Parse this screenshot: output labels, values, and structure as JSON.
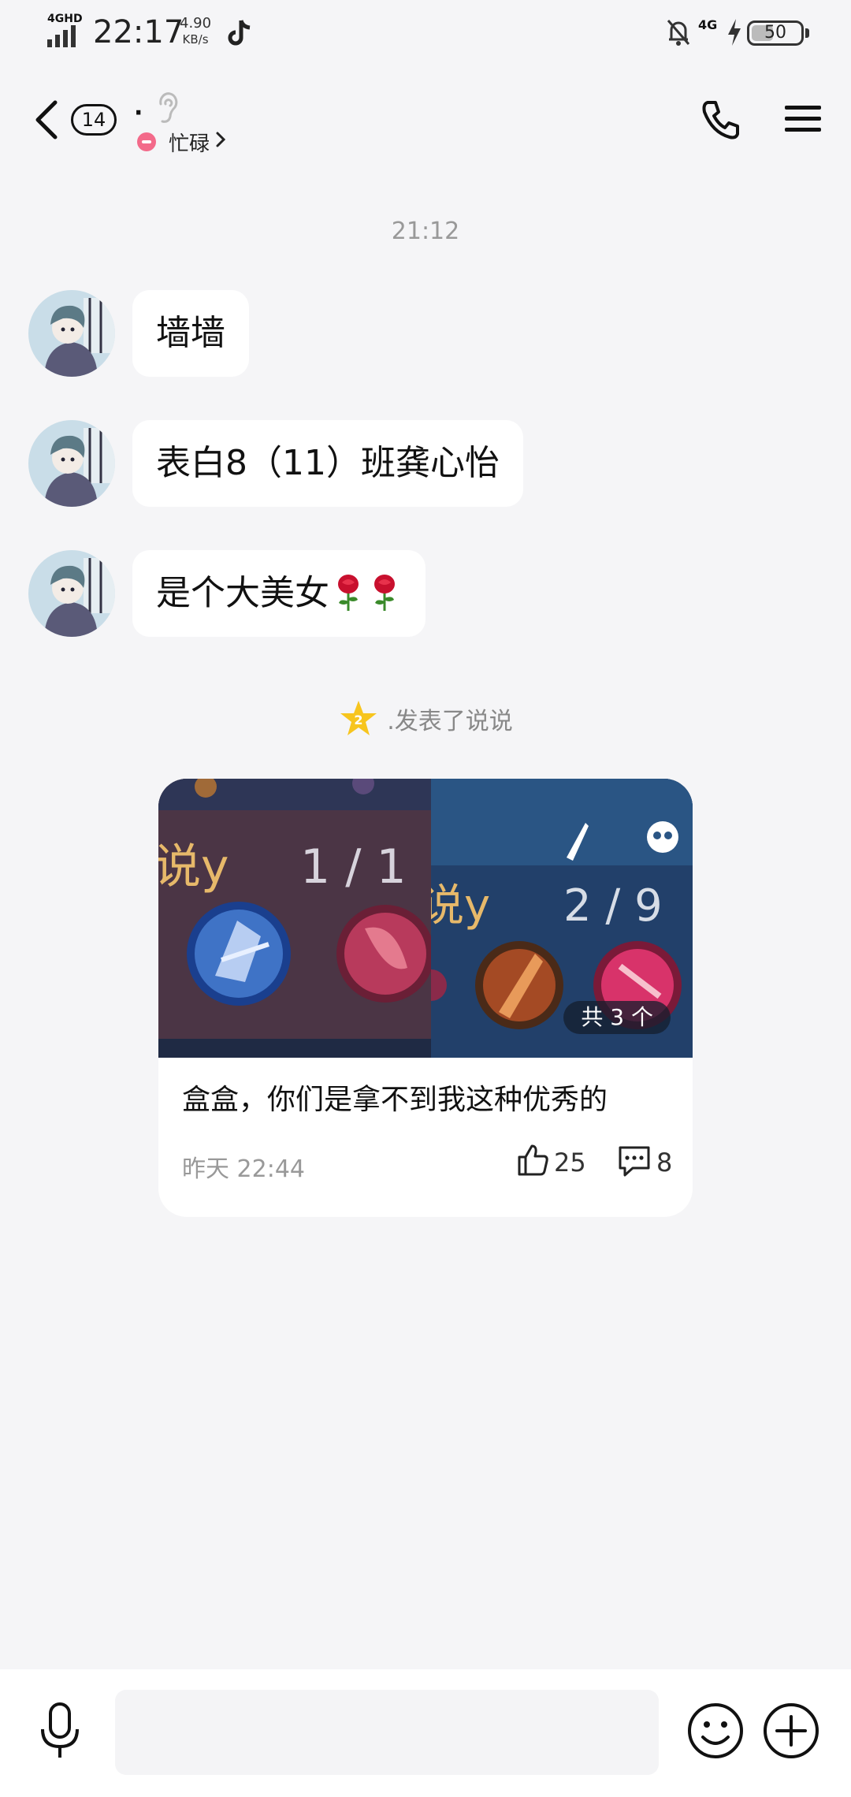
{
  "status_bar": {
    "network_label": "4GHD",
    "time": "22:17",
    "speed_value": "4.90",
    "speed_unit": "KB/s",
    "cell_label": "4G",
    "battery": "50",
    "battery_level": 0.5
  },
  "header": {
    "unread_count": "14",
    "contact_name": "·",
    "status_text": "忙碌"
  },
  "chat": {
    "timestamp": "21:12",
    "messages": [
      {
        "text": "墙墙"
      },
      {
        "text": "表白8（11）班龚心怡"
      },
      {
        "text": "是个大美女"
      }
    ],
    "activity_text": ".发表了说说"
  },
  "post": {
    "image_count": "共 3 个",
    "image_left_text": "说y",
    "image_left_score": "1 / 1",
    "image_right_text": "说y",
    "image_right_score": "2 / 9",
    "caption": "盒盒，你们是拿不到我这种优秀的",
    "time": "昨天 22:44",
    "likes": "25",
    "comments": "8"
  },
  "input": {
    "placeholder": ""
  },
  "colors": {
    "background": "#f5f5f7",
    "status_busy": "#f36a8a",
    "star": "#f7c51e"
  },
  "icons": [
    "signal-icon",
    "tiktok-icon",
    "bell-off-icon",
    "charging-icon",
    "back-icon",
    "ear-icon",
    "phone-icon",
    "menu-icon",
    "rose-icon",
    "star-icon",
    "like-icon",
    "comment-icon",
    "mic-icon",
    "emoji-icon",
    "plus-icon"
  ]
}
